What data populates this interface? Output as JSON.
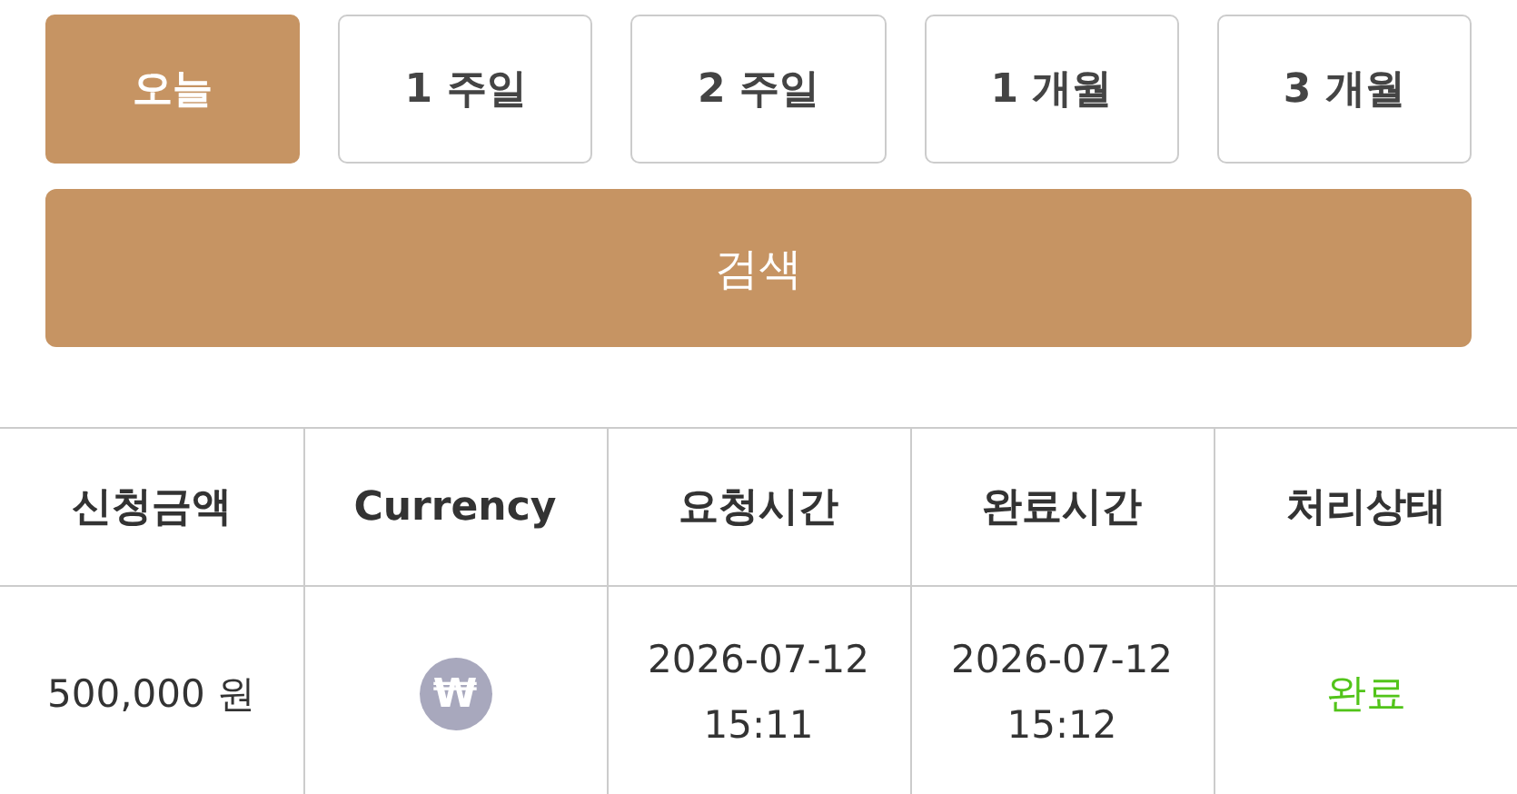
{
  "periods": [
    {
      "label": "오늘",
      "selected": true
    },
    {
      "label": "1 주일",
      "selected": false
    },
    {
      "label": "2 주일",
      "selected": false
    },
    {
      "label": "1 개월",
      "selected": false
    },
    {
      "label": "3 개월",
      "selected": false
    }
  ],
  "search_button": "검색",
  "table": {
    "columns": [
      "신청금액",
      "Currency",
      "요청시간",
      "완료시간",
      "처리상태"
    ],
    "rows": [
      {
        "amount": "500,000 원",
        "currency": "₩",
        "requested": "2026-07-12 15:11",
        "completed": "2026-07-12 15:12",
        "status": "완료",
        "kind": "done"
      }
    ]
  }
}
